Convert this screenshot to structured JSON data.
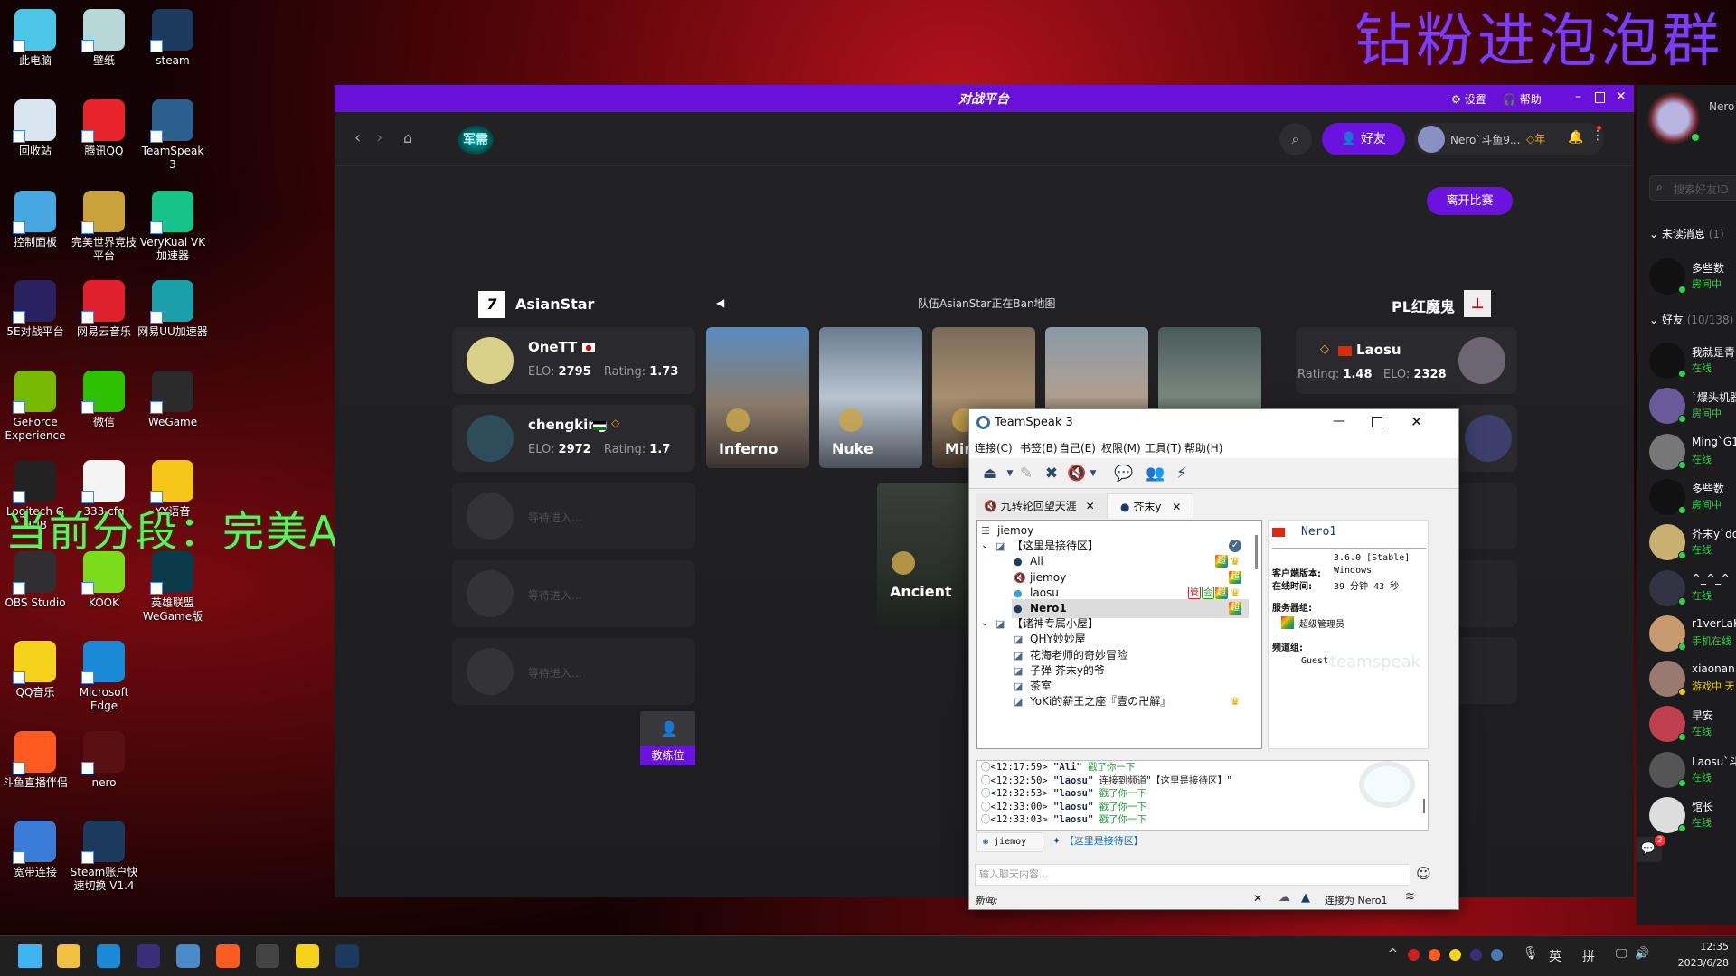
{
  "overlays": {
    "top_right": "钻粉进泡泡群",
    "left": "当前分段：完美A"
  },
  "desktop": {
    "icons": [
      {
        "label": "此电脑",
        "color": "#4cc6e8"
      },
      {
        "label": "壁纸",
        "color": "#b8d8d8"
      },
      {
        "label": "steam",
        "color": "#1b3a5e"
      },
      {
        "label": "回收站",
        "color": "#d9e6ef"
      },
      {
        "label": "腾讯QQ",
        "color": "#e7242a"
      },
      {
        "label": "TeamSpeak 3",
        "color": "#2b5f8e"
      },
      {
        "label": "控制面板",
        "color": "#47a7e0"
      },
      {
        "label": "完美世界竞技平台",
        "color": "#c9a23a"
      },
      {
        "label": "VeryKuai VK加速器",
        "color": "#16c48a"
      },
      {
        "label": "5E对战平台",
        "color": "#2a2260"
      },
      {
        "label": "网易云音乐",
        "color": "#e0202c"
      },
      {
        "label": "网易UU加速器",
        "color": "#1aa0a8"
      },
      {
        "label": "GeForce Experience",
        "color": "#76b900"
      },
      {
        "label": "微信",
        "color": "#2dc100"
      },
      {
        "label": "WeGame",
        "color": "#2b2b2b"
      },
      {
        "label": "Logitech G HUB",
        "color": "#222"
      },
      {
        "label": "333.cfg",
        "color": "#f4f4f4"
      },
      {
        "label": "YY语音",
        "color": "#f5c518"
      },
      {
        "label": "OBS Studio",
        "color": "#302e31"
      },
      {
        "label": "KOOK",
        "color": "#7adc1c"
      },
      {
        "label": "英雄联盟WeGame版",
        "color": "#0b3b4a"
      },
      {
        "label": "QQ音乐",
        "color": "#f5d21c"
      },
      {
        "label": "Microsoft Edge",
        "color": "#1b8ad6"
      },
      {
        "label": "斗鱼直播伴侣",
        "color": "#ff5a1f"
      },
      {
        "label": "nero",
        "color": "#5a0f12"
      },
      {
        "label": "宽带连接",
        "color": "#3a7cd8"
      },
      {
        "label": "Steam账户快速切换 V1.4",
        "color": "#1b3a5e"
      }
    ]
  },
  "game": {
    "brand": "对战平台",
    "title_actions": {
      "settings": "设置",
      "help": "帮助"
    },
    "nav": {
      "section_logo": "军需",
      "friends_button": "好友",
      "username": "Nero`斗鱼9...",
      "badge": "年"
    },
    "leave_button": "离开比赛",
    "ban_status": "队伍AsianStar正在Ban地图",
    "left_team": {
      "name": "AsianStar",
      "players": [
        {
          "name": "OneTT",
          "elo": "2795",
          "rating": "1.73",
          "flag": "jp"
        },
        {
          "name": "chengking",
          "elo": "2972",
          "rating": "1.7",
          "flag": "jo"
        }
      ],
      "waiting": [
        "等待进入...",
        "等待进入...",
        "等待进入..."
      ]
    },
    "right_team": {
      "name": "PL红魔鬼",
      "players": [
        {
          "name": "Laosu",
          "elo": "2328",
          "rating": "1.48",
          "flag": "cn"
        }
      ]
    },
    "labels": {
      "elo": "ELO:",
      "rating": "Rating:"
    },
    "maps": [
      "Inferno",
      "Nuke",
      "Mirage",
      "",
      ""
    ],
    "maps_row2": [
      "Ancient"
    ],
    "coach": "教练位"
  },
  "friends": {
    "me": "Nero`",
    "search_placeholder": "搜索好友ID",
    "unread": {
      "label": "未读消息",
      "count": "(1)"
    },
    "friends_header": {
      "label": "好友",
      "count": "(10/138)"
    },
    "unread_items": [
      {
        "name": "多些数",
        "status": "房间中"
      }
    ],
    "items": [
      {
        "name": "我就是青",
        "status": "在线",
        "color": "#2fd24a"
      },
      {
        "name": "`爆头机器",
        "status": "房间中",
        "color": "#2fd24a"
      },
      {
        "name": "Ming`G1c",
        "status": "在线",
        "color": "#2fd24a"
      },
      {
        "name": "多些数",
        "status": "房间中",
        "color": "#2fd24a"
      },
      {
        "name": "芥末y`do",
        "status": "在线",
        "color": "#2fd24a"
      },
      {
        "name": "^_^_^",
        "status": "在线",
        "color": "#2fd24a"
      },
      {
        "name": "r1verLaK",
        "status": "手机在线",
        "color": "#2fd24a"
      },
      {
        "name": "xiaonan",
        "status": "游戏中 天",
        "color": "#e8c21a"
      },
      {
        "name": "早安",
        "status": "在线",
        "color": "#2fd24a"
      },
      {
        "name": "Laosu`斗",
        "status": "在线",
        "color": "#2fd24a"
      },
      {
        "name": "馆长",
        "status": "在线",
        "color": "#2fd24a"
      }
    ],
    "chat_badge": "2"
  },
  "teamspeak": {
    "title": "TeamSpeak 3",
    "menu": [
      "连接(C)",
      "书签(B)",
      "自己(E)",
      "权限(M)",
      "工具(T)",
      "帮助(H)"
    ],
    "tabs": [
      {
        "label": "九转轮回望天涯"
      },
      {
        "label": "芥末y"
      }
    ],
    "tree": [
      {
        "indent": 0,
        "type": "server",
        "name": "jiemoy"
      },
      {
        "indent": 1,
        "type": "channel",
        "name": "【这里是接待区】",
        "expanded": true,
        "badges": [
          "check"
        ]
      },
      {
        "indent": 2,
        "type": "user",
        "name": "Ali",
        "badges": [
          "超",
          "crown"
        ]
      },
      {
        "indent": 2,
        "type": "muted",
        "name": "jiemoy",
        "badges": [
          "超"
        ]
      },
      {
        "indent": 2,
        "type": "talk",
        "name": "laosu",
        "badges": [
          "管",
          "会",
          "超",
          "crown"
        ]
      },
      {
        "indent": 2,
        "type": "user",
        "name": "Nero1",
        "bold": true,
        "selected": true,
        "badges": [
          "超"
        ]
      },
      {
        "indent": 1,
        "type": "channel",
        "name": "【诸神专属小屋】",
        "expanded": true
      },
      {
        "indent": 2,
        "type": "channel",
        "name": "QHY妙妙屋"
      },
      {
        "indent": 2,
        "type": "channel",
        "name": "花海老师的奇妙冒险"
      },
      {
        "indent": 2,
        "type": "channel",
        "name": "子弹  芥末y的爷"
      },
      {
        "indent": 2,
        "type": "channel",
        "name": "茶室"
      },
      {
        "indent": 2,
        "type": "channel",
        "name": "YoKi的薪王之座『壹の卍解』",
        "badges": [
          "crown"
        ]
      }
    ],
    "info": {
      "name": "Nero1",
      "version": "3.6.0 [Stable]",
      "version_label": "客户端版本:",
      "platform": "Windows",
      "online_label": "在线时间:",
      "online": "39 分钟 43 秒",
      "server_group_label": "服务器组:",
      "server_group": "超级管理员",
      "channel_group_label": "频道组:",
      "channel_group": "Guest",
      "watermark": "teamspeak"
    },
    "chat": [
      {
        "time": "<12:17:59>",
        "who": "\"Ali\"",
        "msg": "戳了你一下",
        "green": true
      },
      {
        "time": "<12:32:50>",
        "who": "\"laosu\"",
        "msg": "连接到频道\"【这里是接待区】\"",
        "green": false
      },
      {
        "time": "<12:32:53>",
        "who": "\"laosu\"",
        "msg": "戳了你一下",
        "green": true
      },
      {
        "time": "<12:33:00>",
        "who": "\"laosu\"",
        "msg": "戳了你一下",
        "green": true
      },
      {
        "time": "<12:33:03>",
        "who": "\"laosu\"",
        "msg": "戳了你一下",
        "green": true
      }
    ],
    "chat_tabs": [
      "jiemoy",
      "【这里是接待区】"
    ],
    "input_placeholder": "输入聊天内容...",
    "news_label": "新闻:",
    "connected_as": "连接为 Nero1"
  },
  "taskbar": {
    "apps": [
      {
        "name": "start",
        "color": "#3fb4f0"
      },
      {
        "name": "file-explorer",
        "color": "#f0c040"
      },
      {
        "name": "edge",
        "color": "#1b8ad6"
      },
      {
        "name": "5e",
        "color": "#3a2e7a"
      },
      {
        "name": "teamspeak",
        "color": "#4a8ac8"
      },
      {
        "name": "douyu",
        "color": "#ff5a1f"
      },
      {
        "name": "obs",
        "color": "#444"
      },
      {
        "name": "qqmusic",
        "color": "#f5d21c"
      },
      {
        "name": "steam",
        "color": "#1b3a5e"
      }
    ],
    "ime1": "英",
    "ime2": "拼",
    "time": "12:35",
    "date": "2023/6/28"
  }
}
